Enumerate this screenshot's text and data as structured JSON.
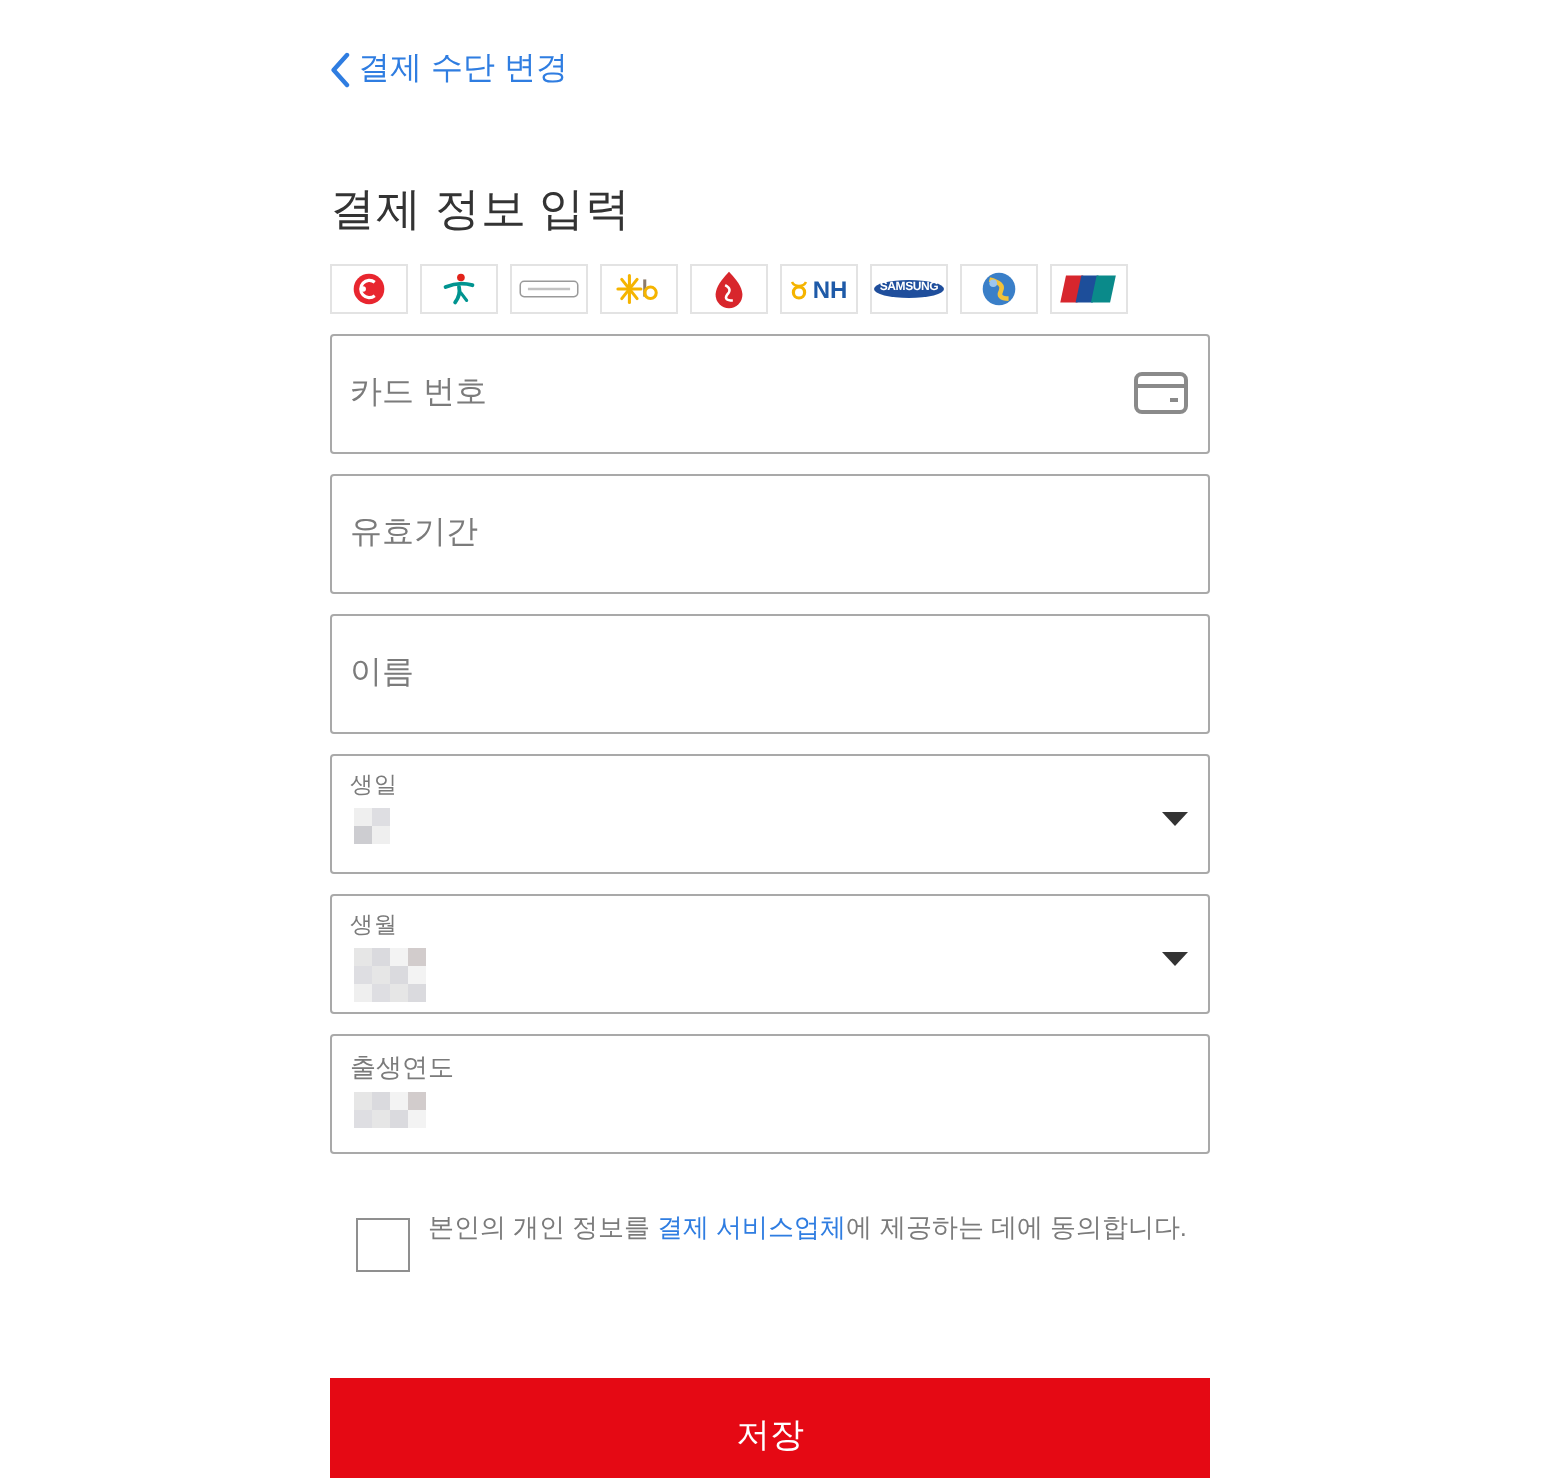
{
  "back_link": {
    "label": "결제 수단 변경"
  },
  "title": "결제 정보 입력",
  "card_logos": [
    {
      "kind": "disc"
    },
    {
      "kind": "figure"
    },
    {
      "kind": "outline"
    },
    {
      "kind": "star"
    },
    {
      "kind": "drop"
    },
    {
      "kind": "ring_text",
      "text": "NH"
    },
    {
      "kind": "oval_text",
      "text": "SAMSUNG"
    },
    {
      "kind": "sphere"
    },
    {
      "kind": "flags"
    }
  ],
  "fields": [
    {
      "kind": "card_input",
      "placeholder": "카드 번호"
    },
    {
      "kind": "input",
      "placeholder": "유효기간"
    },
    {
      "kind": "input",
      "placeholder": "이름"
    },
    {
      "kind": "select",
      "label": "생일",
      "value_hidden": true
    },
    {
      "kind": "select",
      "label": "생월",
      "value_hidden": true
    },
    {
      "kind": "labeled",
      "label": "출생연도",
      "value_hidden": true
    }
  ],
  "consent": {
    "checked": false,
    "text_before": "본인의 개인 정보를 ",
    "link": "결제 서비스업체",
    "text_after": "에 제공하는 데에 동의합니다."
  },
  "save_button": {
    "label": "저장"
  }
}
